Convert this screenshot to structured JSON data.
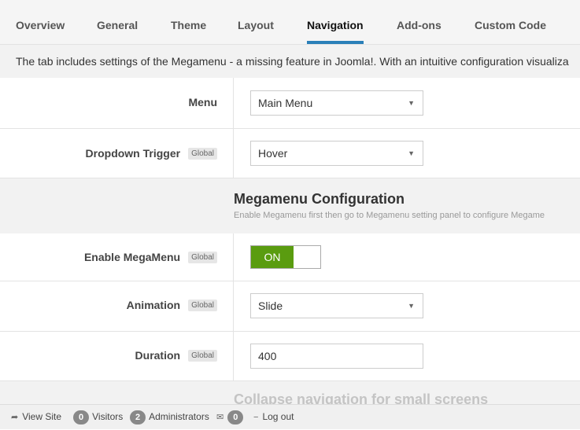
{
  "tabs": [
    {
      "label": "Overview"
    },
    {
      "label": "General"
    },
    {
      "label": "Theme"
    },
    {
      "label": "Layout"
    },
    {
      "label": "Navigation"
    },
    {
      "label": "Add-ons"
    },
    {
      "label": "Custom Code"
    }
  ],
  "active_tab": "Navigation",
  "intro_text": "The tab includes settings of the Megamenu - a missing feature in Joomla!. With an intuitive configuration visualiza",
  "global_badge": "Global",
  "fields": {
    "menu": {
      "label": "Menu",
      "value": "Main Menu"
    },
    "dropdown_trigger": {
      "label": "Dropdown Trigger",
      "value": "Hover"
    },
    "enable_megamenu": {
      "label": "Enable MegaMenu",
      "value": "ON"
    },
    "animation": {
      "label": "Animation",
      "value": "Slide"
    },
    "duration": {
      "label": "Duration",
      "value": "400"
    }
  },
  "sections": {
    "megamenu": {
      "title": "Megamenu Configuration",
      "desc": "Enable Megamenu first then go to Megamenu setting panel to configure Megame"
    },
    "collapse": {
      "title": "Collapse navigation for small screens"
    }
  },
  "footer": {
    "view_site": "View Site",
    "visitors_count": "0",
    "visitors_label": "Visitors",
    "admins_count": "2",
    "admins_label": "Administrators",
    "messages_count": "0",
    "logout": "Log out"
  },
  "colors": {
    "accent": "#2a7fb8",
    "toggle_on": "#5a9c10"
  }
}
